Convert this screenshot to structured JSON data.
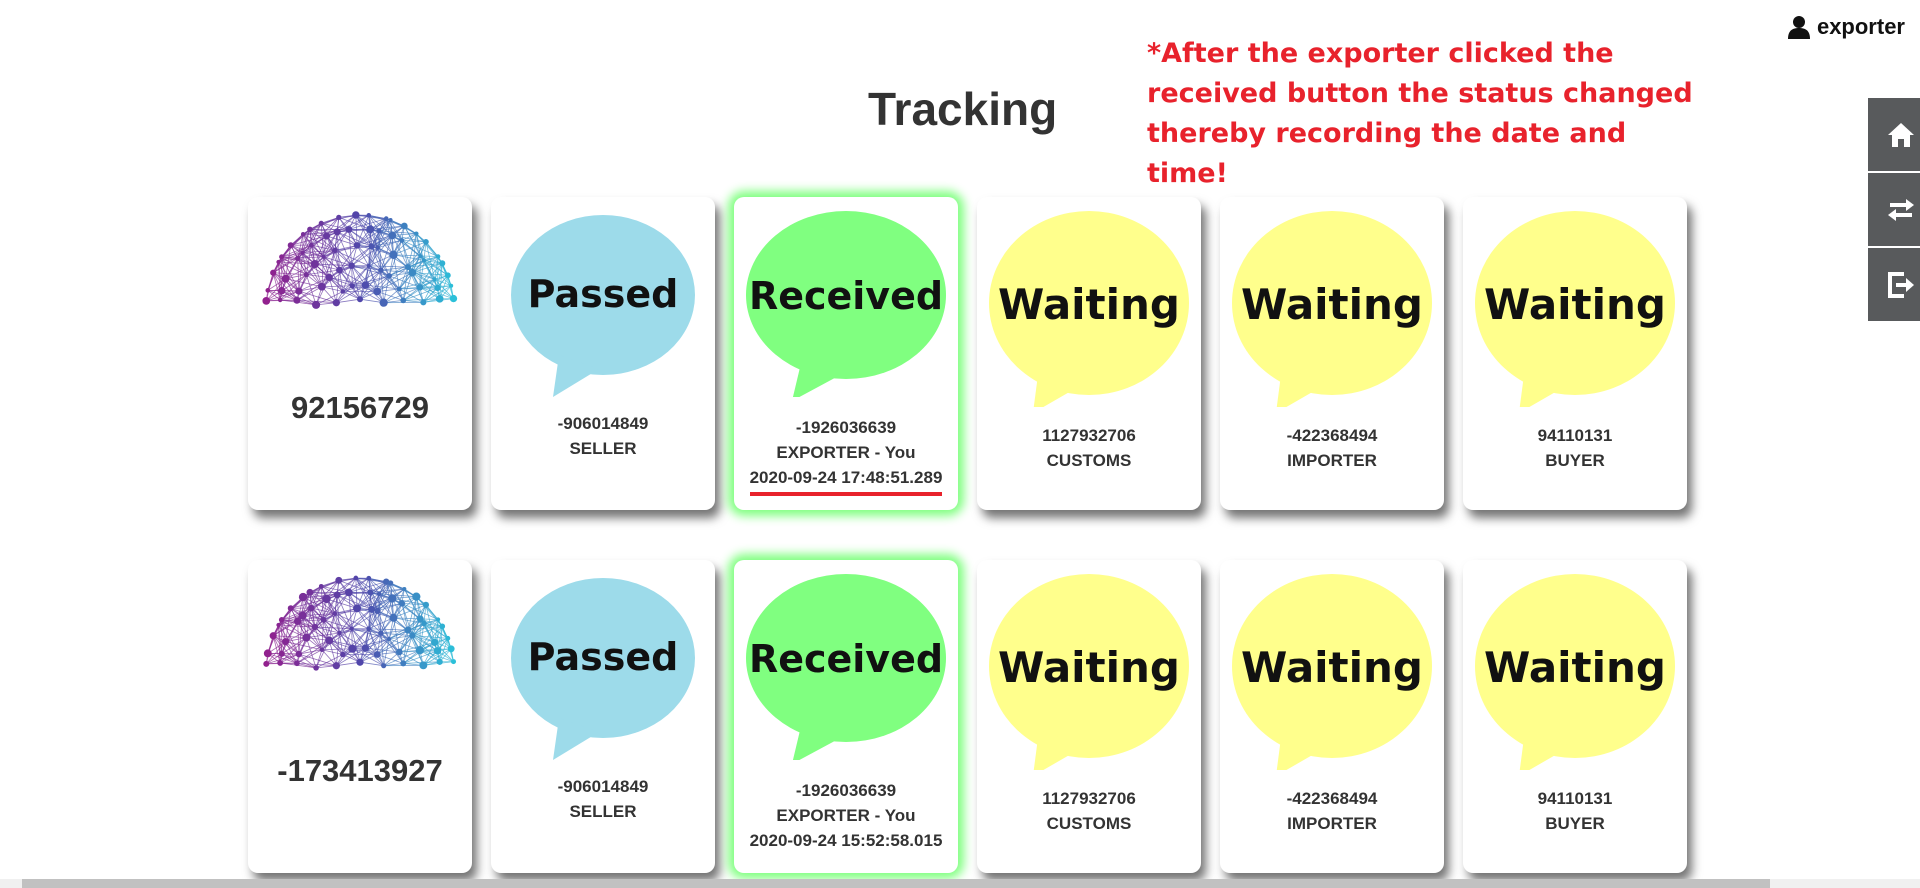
{
  "header": {
    "username": "exporter",
    "page_title": "Tracking"
  },
  "annotation": {
    "text": "*After the exporter clicked the received button the status changed thereby recording the date and time!",
    "color": "#e8222c"
  },
  "side_menu": [
    {
      "icon": "home-icon"
    },
    {
      "icon": "transfer-icon"
    },
    {
      "icon": "logout-icon"
    }
  ],
  "colors": {
    "passed": "#9ddbea",
    "received": "#80ff80",
    "waiting": "#ffff8c"
  },
  "rows": [
    {
      "product_id": "92156729",
      "stages": [
        {
          "status": "Passed",
          "id": "-906014849",
          "role": "SELLER"
        },
        {
          "status": "Received",
          "id": "-1926036639",
          "role": "EXPORTER - You",
          "timestamp": "2020-09-24 17:48:51.289"
        },
        {
          "status": "Waiting",
          "id": "1127932706",
          "role": "CUSTOMS"
        },
        {
          "status": "Waiting",
          "id": "-422368494",
          "role": "IMPORTER"
        },
        {
          "status": "Waiting",
          "id": "94110131",
          "role": "BUYER"
        }
      ]
    },
    {
      "product_id": "-173413927",
      "stages": [
        {
          "status": "Passed",
          "id": "-906014849",
          "role": "SELLER"
        },
        {
          "status": "Received",
          "id": "-1926036639",
          "role": "EXPORTER - You",
          "timestamp": "2020-09-24 15:52:58.015"
        },
        {
          "status": "Waiting",
          "id": "1127932706",
          "role": "CUSTOMS"
        },
        {
          "status": "Waiting",
          "id": "-422368494",
          "role": "IMPORTER"
        },
        {
          "status": "Waiting",
          "id": "94110131",
          "role": "BUYER"
        }
      ]
    }
  ]
}
